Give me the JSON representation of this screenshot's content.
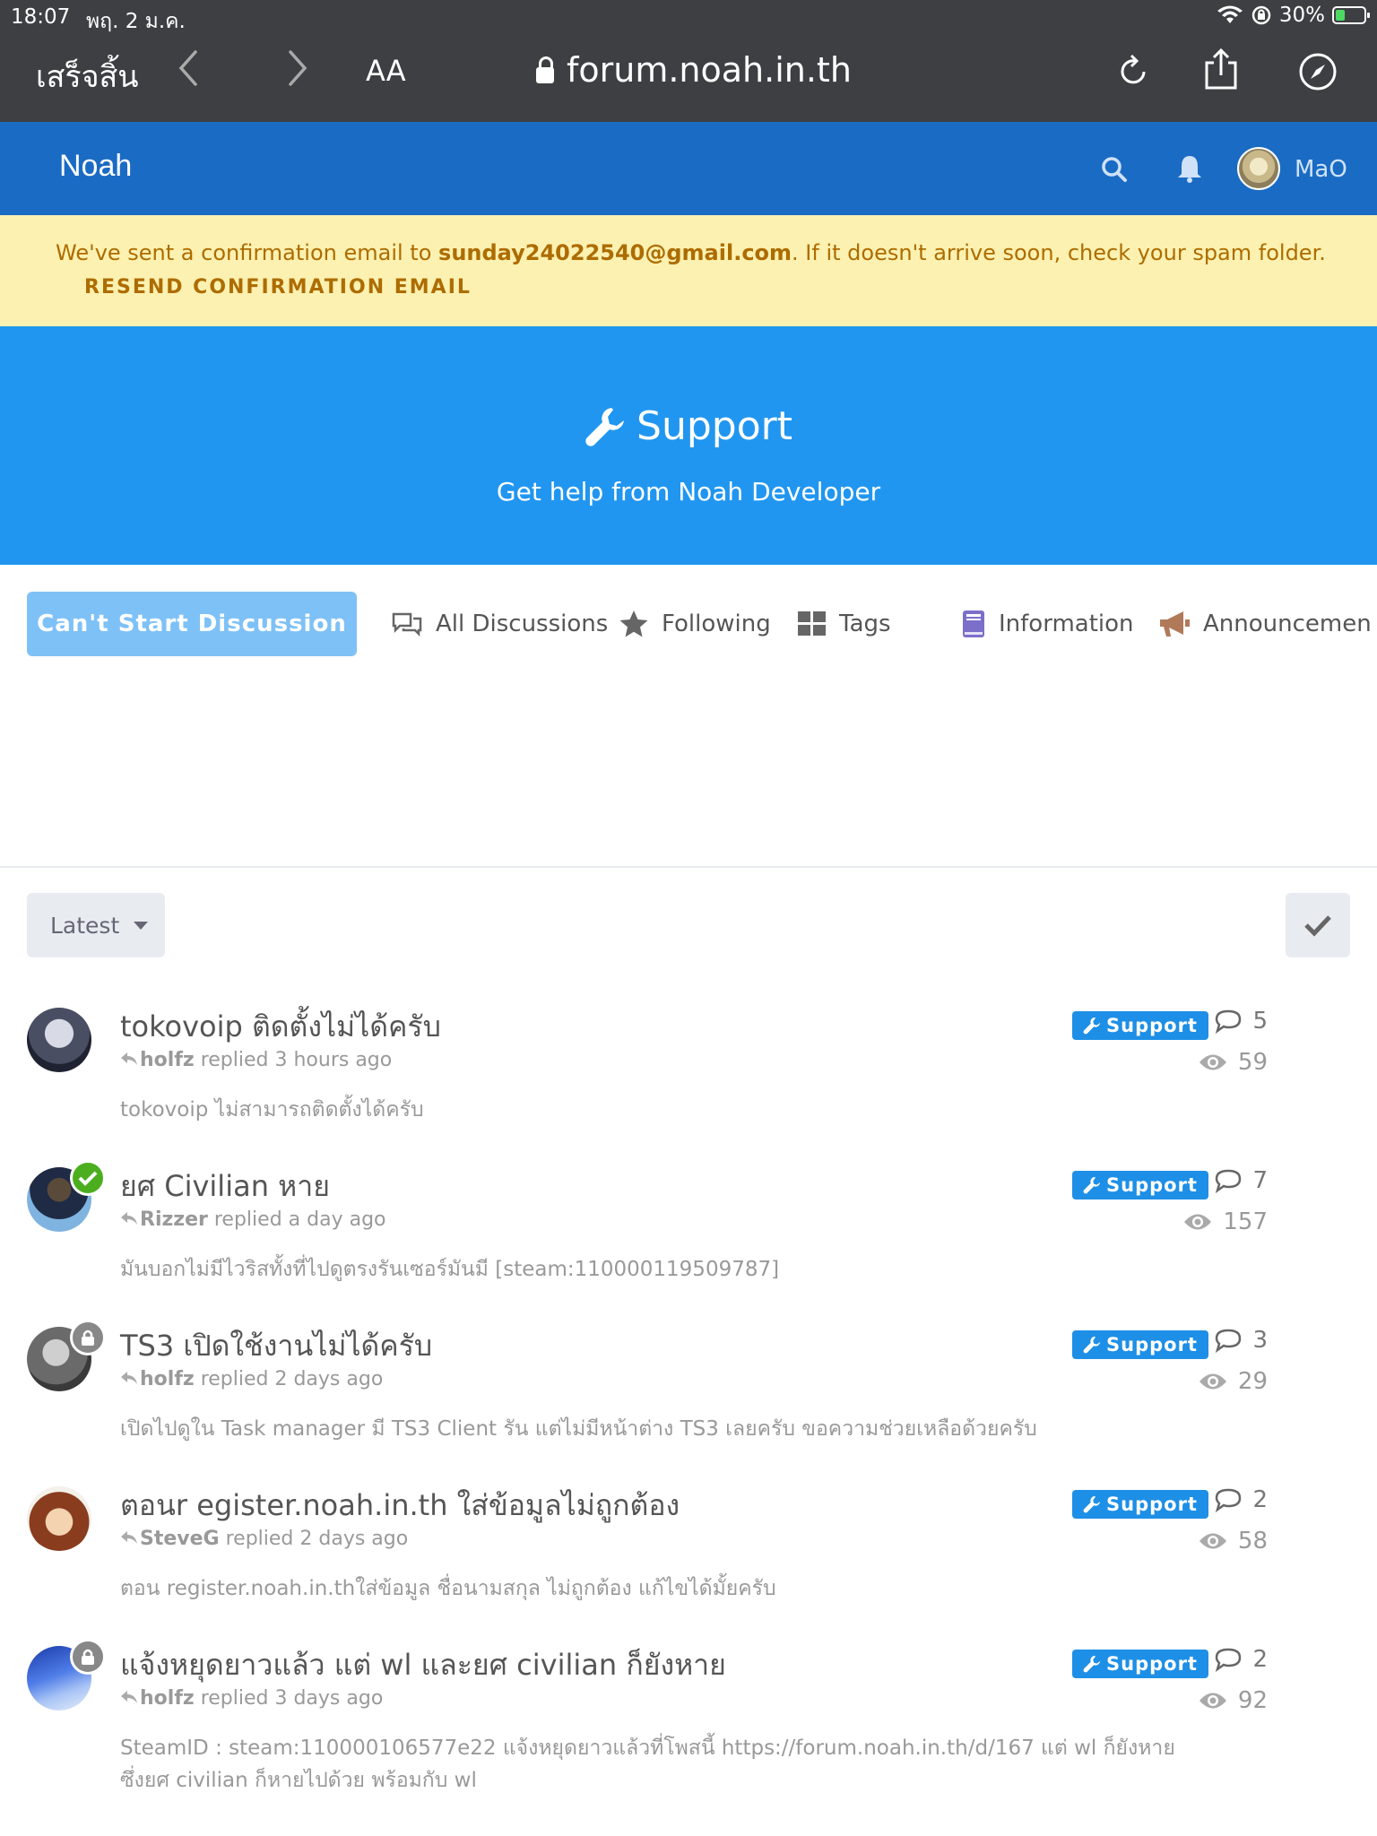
{
  "status_bar": {
    "time": "18:07",
    "date": "พฤ. 2 ม.ค.",
    "battery": "30%"
  },
  "browser": {
    "done_label": "เสร็จสิ้น",
    "text_size": "AA",
    "url": "forum.noah.in.th"
  },
  "header": {
    "brand": "Noah",
    "username": "MaO"
  },
  "alert": {
    "prefix": "We've sent a confirmation email to ",
    "email": "sunday24022540@gmail.com",
    "suffix": ". If it doesn't arrive soon, check your spam folder.",
    "resend_label": "RESEND CONFIRMATION EMAIL"
  },
  "hero": {
    "title": "Support",
    "description": "Get help from Noah Developer"
  },
  "nav": {
    "start_label": "Can't Start Discussion",
    "items": [
      "All Discussions",
      "Following",
      "Tags",
      "Information",
      "Announcemen"
    ]
  },
  "toolbar": {
    "sort_label": "Latest"
  },
  "discussions": [
    {
      "title": "tokovoip ติดตั้งไม่ได้ครับ",
      "user": "holfz",
      "action": " replied 3 hours ago",
      "excerpt": "tokovoip ไม่สามารถติดตั้งได้ครับ",
      "tag": "Support",
      "replies": "5",
      "views": "59",
      "badge": ""
    },
    {
      "title": "ยศ Civilian หาย",
      "user": "Rizzer",
      "action": " replied a day ago",
      "excerpt": "มันบอกไม่มีไวริสทั้งที่ไปดูตรงรันเซอร์มันมี [steam:110000119509787]",
      "tag": "Support",
      "replies": "7",
      "views": "157",
      "badge": "check"
    },
    {
      "title": "TS3 เปิดใช้งานไม่ได้ครับ",
      "user": "holfz",
      "action": " replied 2 days ago",
      "excerpt": "เปิดไปดูใน Task manager มี TS3 Client รัน แต่ไม่มีหน้าต่าง TS3 เลยครับ ขอความช่วยเหลือด้วยครับ",
      "tag": "Support",
      "replies": "3",
      "views": "29",
      "badge": "lock"
    },
    {
      "title": "ตอนr egister.noah.in.th ใส่ข้อมูลไม่ถูกต้อง",
      "user": "SteveG",
      "action": " replied 2 days ago",
      "excerpt": "ตอน register.noah.in.thใส่ข้อมูล ชื่อนามสกุล ไม่ถูกต้อง แก้ไขได้มั้ยครับ",
      "tag": "Support",
      "replies": "2",
      "views": "58",
      "badge": ""
    },
    {
      "title": "แจ้งหยุดยาวแล้ว แต่ wl และยศ civilian ก็ยังหาย",
      "user": "holfz",
      "action": " replied 3 days ago",
      "excerpt": "SteamID : steam:110000106577e22 แจ้งหยุดยาวแล้วที่โพสนี้ https://forum.noah.in.th/d/167 แต่ wl ก็ยังหาย ซึ่งยศ civilian ก็หายไปด้วย พร้อมกับ wl",
      "tag": "Support",
      "replies": "2",
      "views": "92",
      "badge": "lock"
    }
  ],
  "colors": {
    "header": "#1a6bc4",
    "hero": "#2196f0",
    "alert_bg": "#fcf1b0",
    "alert_text": "#ad6c00",
    "tag": "#1e8fe6"
  }
}
